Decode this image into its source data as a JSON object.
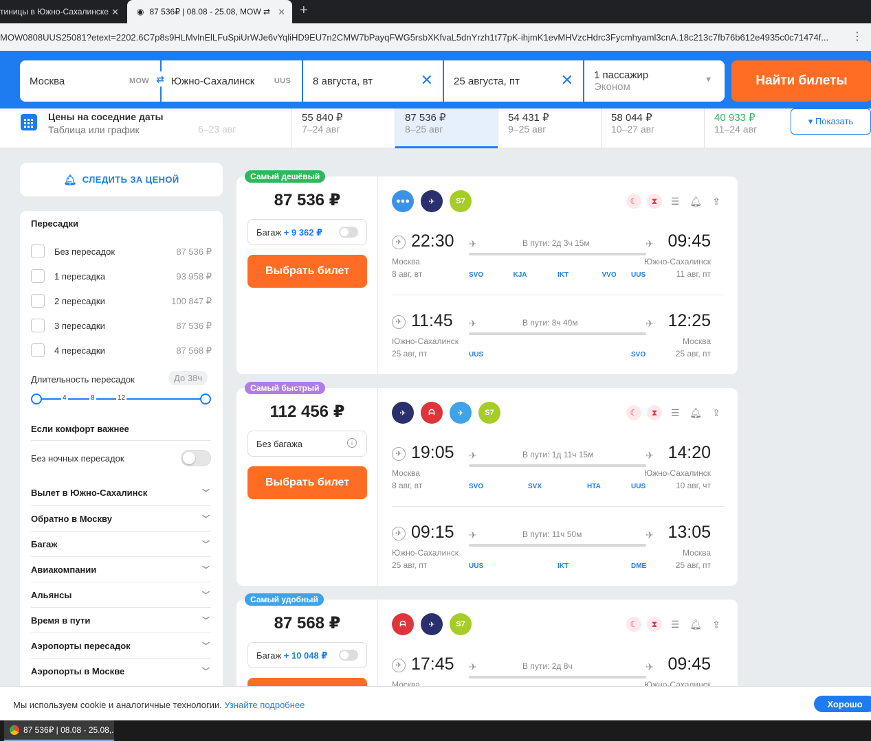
{
  "browser": {
    "tab1_title": "тиницы в Южно-Сахалинске",
    "tab2_title": "87 536₽ | 08.08 - 25.08, MOW ⇄",
    "new_tab": "+",
    "url": "MOW0808UUS25081?etext=2202.6C7p8s9HLMvlnElLFuSpiUrWJe6vYqliHD9EU7n2CMW7bPayqFWG5rsbXKfvaL5dnYrzh1t77pK-ihjmK1evMHVzcHdrc3Fycmhyaml3cnA.18c213c7fb76b612e4935c0c71474f..."
  },
  "search": {
    "from_city": "Москва",
    "from_code": "MOW",
    "to_city": "Южно-Сахалинск",
    "to_code": "UUS",
    "date_out": "8 августа, вт",
    "date_back": "25 августа, пт",
    "pax": "1 пассажир",
    "cabin": "Эконом",
    "find_button": "Найти билеты",
    "clear_icon": "✕"
  },
  "price_strip": {
    "title": "Цены на соседние даты",
    "subtitle": "Таблица или график",
    "show_button": "▾ Показать",
    "dates": [
      {
        "price": "",
        "range": "6–23 авг"
      },
      {
        "price": "55 840 ₽",
        "range": "7–24 авг"
      },
      {
        "price": "87 536 ₽",
        "range": "8–25 авг"
      },
      {
        "price": "54 431 ₽",
        "range": "9–25 авг"
      },
      {
        "price": "58 044 ₽",
        "range": "10–27 авг"
      },
      {
        "price": "40 933 ₽",
        "range": "11–24 авг"
      }
    ]
  },
  "sidebar": {
    "follow_price": "СЛЕДИТЬ ЗА ЦЕНОЙ",
    "transfers_title": "Пересадки",
    "transfers": [
      {
        "label": "Без пересадок",
        "price": "87 536 ₽"
      },
      {
        "label": "1 пересадка",
        "price": "93 958 ₽"
      },
      {
        "label": "2 пересадки",
        "price": "100 847 ₽"
      },
      {
        "label": "3 пересадки",
        "price": "87 536 ₽"
      },
      {
        "label": "4 пересадки",
        "price": "87 568 ₽"
      }
    ],
    "duration_title": "Длительность пересадок",
    "duration_value": "До 38ч",
    "slider_ticks": [
      "4",
      "8",
      "12"
    ],
    "comfort_title": "Если комфорт важнее",
    "no_night": "Без ночных пересадок",
    "accordions": [
      "Вылет в Южно-Сахалинск",
      "Обратно в Москву",
      "Багаж",
      "Авиакомпании",
      "Альянсы",
      "Время в пути",
      "Аэропорты пересадок",
      "Аэропорты в Москве"
    ]
  },
  "cards": [
    {
      "badge": "Самый дешёвый",
      "badge_color": "#2eb85c",
      "price": "87 536 ₽",
      "bag_label": "Багаж",
      "bag_price": "+ 9 362 ₽",
      "choose": "Выбрать билет",
      "airlines": [
        {
          "name": "pobeda-dots",
          "color": "#3b93e8",
          "text": "●●●"
        },
        {
          "name": "rossiya",
          "color": "#2a2f6e",
          "text": "✈"
        },
        {
          "name": "s7",
          "color": "#a6cd26",
          "text": "S7"
        }
      ],
      "segments": [
        {
          "dep": "22:30",
          "arr": "09:45",
          "from": "Москва",
          "from_date": "8 авг, вт",
          "to": "Южно-Сахалинск",
          "to_date": "11 авг, пт",
          "dur": "В пути: 2д 3ч 15м",
          "codes": [
            "SVO",
            "KJA",
            "IKT",
            "VVO",
            "UUS"
          ]
        },
        {
          "dep": "11:45",
          "arr": "12:25",
          "from": "Южно-Сахалинск",
          "from_date": "25 авг, пт",
          "to": "Москва",
          "to_date": "25 авг, пт",
          "dur": "В пути: 8ч 40м",
          "codes": [
            "UUS",
            "SVO"
          ]
        }
      ]
    },
    {
      "badge": "Самый быстрый",
      "badge_color": "#b07de8",
      "price": "112 456 ₽",
      "bag_label": "Без багажа",
      "choose": "Выбрать билет",
      "airlines": [
        {
          "name": "rossiya",
          "color": "#2a2f6e",
          "text": "✈"
        },
        {
          "name": "aurora",
          "color": "#e0343b",
          "text": "ᗩ"
        },
        {
          "name": "yakutia",
          "color": "#3ea3e8",
          "text": "✈"
        },
        {
          "name": "s7",
          "color": "#a6cd26",
          "text": "S7"
        }
      ],
      "segments": [
        {
          "dep": "19:05",
          "arr": "14:20",
          "from": "Москва",
          "from_date": "8 авг, вт",
          "to": "Южно-Сахалинск",
          "to_date": "10 авг, чт",
          "dur": "В пути: 1д 11ч 15м",
          "codes": [
            "SVO",
            "SVX",
            "HTA",
            "UUS"
          ]
        },
        {
          "dep": "09:15",
          "arr": "13:05",
          "from": "Южно-Сахалинск",
          "from_date": "25 авг, пт",
          "to": "Москва",
          "to_date": "25 авг, пт",
          "dur": "В пути: 11ч 50м",
          "codes": [
            "UUS",
            "IKT",
            "DME"
          ]
        }
      ]
    },
    {
      "badge": "Самый удобный",
      "badge_color": "#3ea3e8",
      "price": "87 568 ₽",
      "bag_label": "Багаж",
      "bag_price": "+ 10 048 ₽",
      "choose": "Выбрать билет",
      "airlines": [
        {
          "name": "aurora",
          "color": "#e0343b",
          "text": "ᗩ"
        },
        {
          "name": "rossiya",
          "color": "#2a2f6e",
          "text": "✈"
        },
        {
          "name": "s7",
          "color": "#a6cd26",
          "text": "S7"
        }
      ],
      "segments": [
        {
          "dep": "17:45",
          "arr": "09:45",
          "from": "Москва",
          "from_date": "",
          "to": "Южно-Сахалинск",
          "to_date": "",
          "dur": "В пути: 2д 8ч",
          "codes": []
        }
      ]
    }
  ],
  "cookie": {
    "text": "Мы используем cookie и аналогичные технологии. ",
    "link": "Узнайте подробнее",
    "ok": "Хорошо"
  },
  "taskbar": {
    "item": "87 536₽ | 08.08 - 25.08,..."
  }
}
